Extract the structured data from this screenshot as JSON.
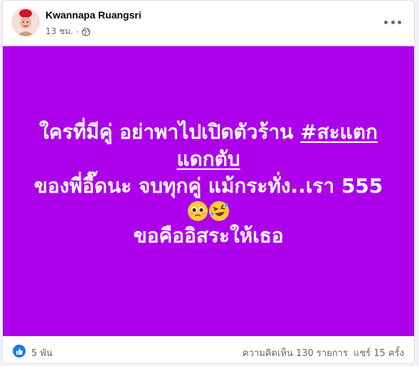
{
  "post": {
    "author": "Kwannapa Ruangsri",
    "time": "13 ชม.",
    "separator": "·",
    "background_color": "#ad00eb",
    "text": {
      "line1_prefix": "ใครที่มีคู่ อย่าพาไปเปิดตัวร้าน",
      "hashtag_part1": "#สะแตก",
      "hashtag_part2": "แดกตับ",
      "line3": "ของพี่อี๊ดนะ จบทุกคู่ แม้กระทั่ง..เรา 555",
      "line5": "ขอคืออิสระให้เธอ"
    },
    "emojis": [
      "pleading-face",
      "rolling-on-floor-laughing"
    ]
  },
  "footer": {
    "reaction_icon": "like-icon",
    "reaction_count": "5 พัน",
    "comments": "ความคิดเห็น 130 รายการ",
    "shares": "แชร์ 15 ครั้ง"
  }
}
